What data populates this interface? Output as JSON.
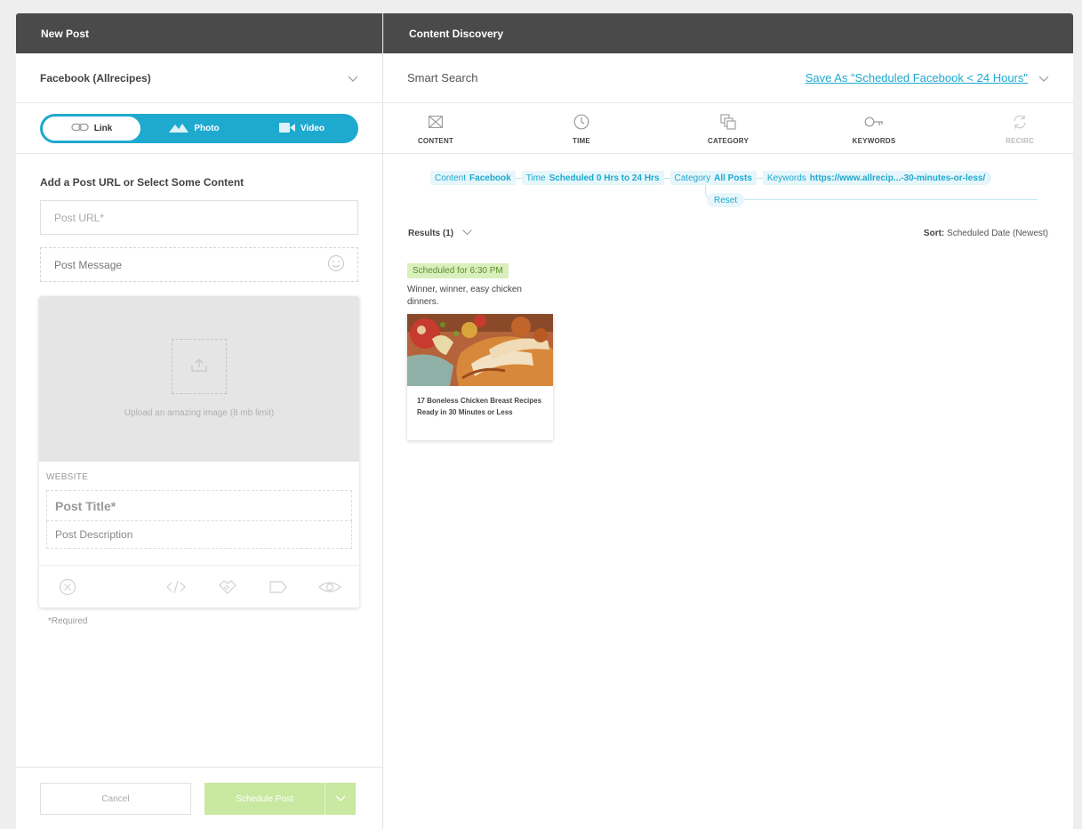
{
  "left_panel": {
    "header": "New Post",
    "account": "Facebook (Allrecipes)",
    "tabs": [
      {
        "label": "Link",
        "icon": "link-icon"
      },
      {
        "label": "Photo",
        "icon": "mountain-icon"
      },
      {
        "label": "Video",
        "icon": "video-camera-icon"
      }
    ],
    "section_title": "Add a Post URL or Select Some Content",
    "url_placeholder": "Post URL*",
    "message_placeholder": "Post Message",
    "upload_text": "Upload an amazing image (8 mb limit)",
    "website_label": "WEBSITE",
    "title_placeholder": "Post Title*",
    "description_placeholder": "Post Description",
    "required_note": "*Required",
    "cancel_label": "Cancel",
    "schedule_label": "Schedule Post"
  },
  "right_panel": {
    "header": "Content Discovery",
    "smart_search": "Smart Search",
    "save_as": "Save As \"Scheduled Facebook < 24 Hours\"",
    "filter_tabs": [
      {
        "label": "CONTENT",
        "icon": "content-icon"
      },
      {
        "label": "TIME",
        "icon": "clock-icon"
      },
      {
        "label": "CATEGORY",
        "icon": "category-icon"
      },
      {
        "label": "KEYWORDS",
        "icon": "key-icon"
      },
      {
        "label": "RECIRC",
        "icon": "recirc-icon"
      }
    ],
    "chips": [
      {
        "key": "Content",
        "value": "Facebook"
      },
      {
        "key": "Time",
        "value": "Scheduled 0 Hrs to 24 Hrs"
      },
      {
        "key": "Category",
        "value": "All Posts"
      },
      {
        "key": "Keywords",
        "value": "https://www.allrecip...-30-minutes-or-less/"
      }
    ],
    "reset_label": "Reset",
    "results_label": "Results (1)",
    "sort_label": "Sort:",
    "sort_value": "Scheduled Date (Newest)",
    "result": {
      "badge": "Scheduled for 6:30 PM",
      "caption": "Winner, winner, easy chicken dinners.",
      "title": "17 Boneless Chicken Breast Recipes Ready in 30 Minutes or Less"
    }
  },
  "colors": {
    "header_bg": "#4a4a4a",
    "accent": "#1ea9cf",
    "schedule_bg": "#c9e8a0",
    "badge_bg": "#d9f0bd"
  }
}
